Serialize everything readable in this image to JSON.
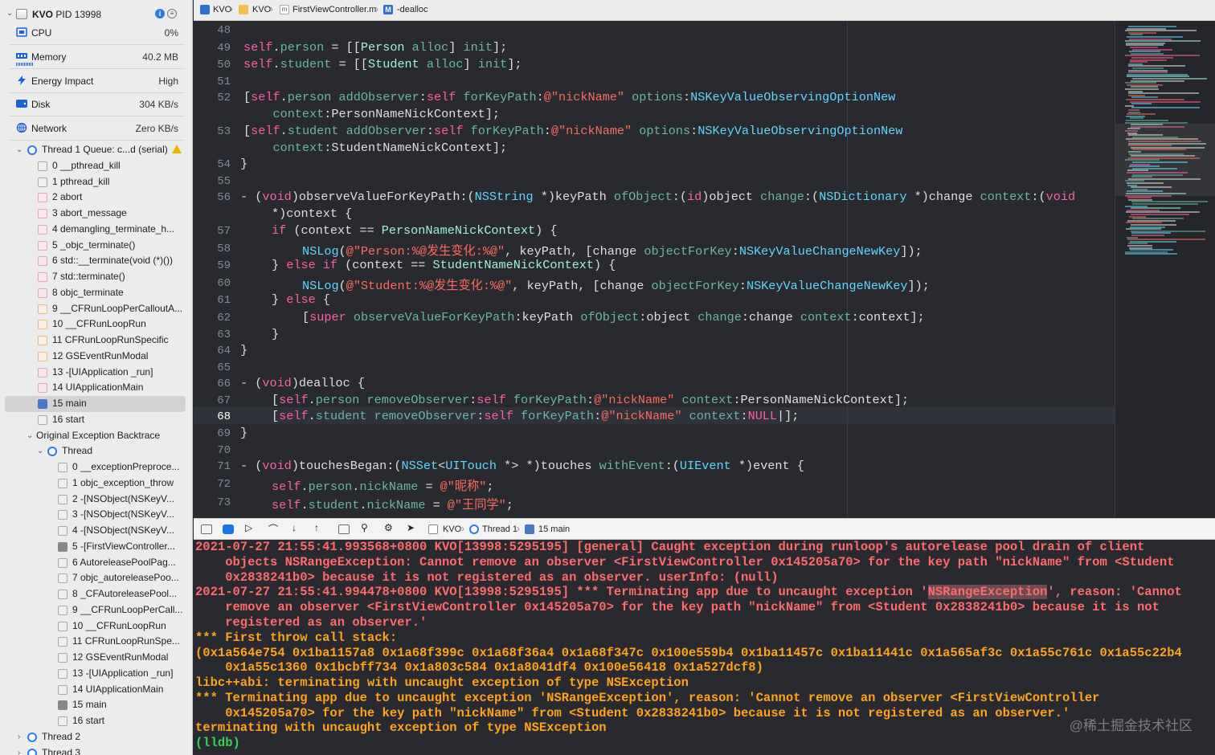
{
  "process": {
    "app": "KVO",
    "pid": "PID 13998"
  },
  "gauges": [
    {
      "label": "CPU",
      "value": "0%"
    },
    {
      "label": "Memory",
      "value": "40.2 MB"
    },
    {
      "label": "Energy Impact",
      "value": "High"
    },
    {
      "label": "Disk",
      "value": "304 KB/s"
    },
    {
      "label": "Network",
      "value": "Zero KB/s"
    }
  ],
  "thread1": {
    "label": "Thread 1 Queue: c...d (serial)",
    "frames": [
      "0 __pthread_kill",
      "1 pthread_kill",
      "2 abort",
      "3 abort_message",
      "4 demangling_terminate_h...",
      "5 _objc_terminate()",
      "6 std::__terminate(void (*)())",
      "7 std::terminate()",
      "8 objc_terminate",
      "9 __CFRunLoopPerCalloutA...",
      "10 __CFRunLoopRun",
      "11 CFRunLoopRunSpecific",
      "12 GSEventRunModal",
      "13 -[UIApplication _run]",
      "14 UIApplicationMain",
      "15 main",
      "16 start"
    ]
  },
  "backtrace": {
    "label": "Original Exception Backtrace",
    "thread_label": "Thread",
    "frames": [
      "0 __exceptionPreproce...",
      "1 objc_exception_throw",
      "2 -[NSObject(NSKeyV...",
      "3 -[NSObject(NSKeyV...",
      "4 -[NSObject(NSKeyV...",
      "5 -[FirstViewController...",
      "6 AutoreleasePoolPag...",
      "7 objc_autoreleasePoo...",
      "8 _CFAutoreleasePool...",
      "9 __CFRunLoopPerCall...",
      "10 __CFRunLoopRun",
      "11 CFRunLoopRunSpe...",
      "12 GSEventRunModal",
      "13 -[UIApplication _run]",
      "14 UIApplicationMain",
      "15 main",
      "16 start"
    ]
  },
  "other_threads": [
    "Thread 2",
    "Thread 3"
  ],
  "jumpbar": {
    "project": "KVO",
    "group": "KVO",
    "file": "FirstViewController.m",
    "method": "-dealloc"
  },
  "editor": {
    "line_numbers": [
      "48",
      "49",
      "50",
      "51",
      "52",
      "",
      "53",
      "",
      "54",
      "55",
      "56",
      "",
      "57",
      "58",
      "59",
      "60",
      "61",
      "62",
      "63",
      "64",
      "65",
      "66",
      "67",
      "68",
      "69",
      "70",
      "71",
      "72",
      "73"
    ],
    "current_line": "68"
  },
  "debugbar": {
    "target": "KVO",
    "thread": "Thread 1",
    "frame": "15 main"
  },
  "console": {
    "lines": [
      "2021-07-27 21:55:41.993568+0800 KVO[13998:5295195] [general] Caught exception during runloop's autorelease pool drain of client",
      "    objects NSRangeException: Cannot remove an observer <FirstViewController 0x145205a70> for the key path \"nickName\" from <Student",
      "    0x2838241b0> because it is not registered as an observer. userInfo: (null)",
      "2021-07-27 21:55:41.994478+0800 KVO[13998:5295195] *** Terminating app due to uncaught exception '",
      "    remove an observer <FirstViewController 0x145205a70> for the key path \"nickName\" from <Student 0x2838241b0> because it is not",
      "    registered as an observer.'",
      "*** First throw call stack:",
      "(0x1a564e754 0x1ba1157a8 0x1a68f399c 0x1a68f36a4 0x1a68f347c 0x100e559b4 0x1ba11457c 0x1ba11441c 0x1a565af3c 0x1a55c761c 0x1a55c22b4",
      "    0x1a55c1360 0x1bcbff734 0x1a803c584 0x1a8041df4 0x100e56418 0x1a527dcf8)",
      "libc++abi: terminating with uncaught exception of type NSException",
      "*** Terminating app due to uncaught exception 'NSRangeException', reason: 'Cannot remove an observer <FirstViewController",
      "    0x145205a70> for the key path \"nickName\" from <Student 0x2838241b0> because it is not registered as an observer.'",
      "terminating with uncaught exception of type NSException",
      "(lldb)"
    ],
    "highlight": "NSRangeException",
    "line4_tail": "', reason: 'Cannot",
    "watermark": "@稀土掘金技术社区"
  }
}
